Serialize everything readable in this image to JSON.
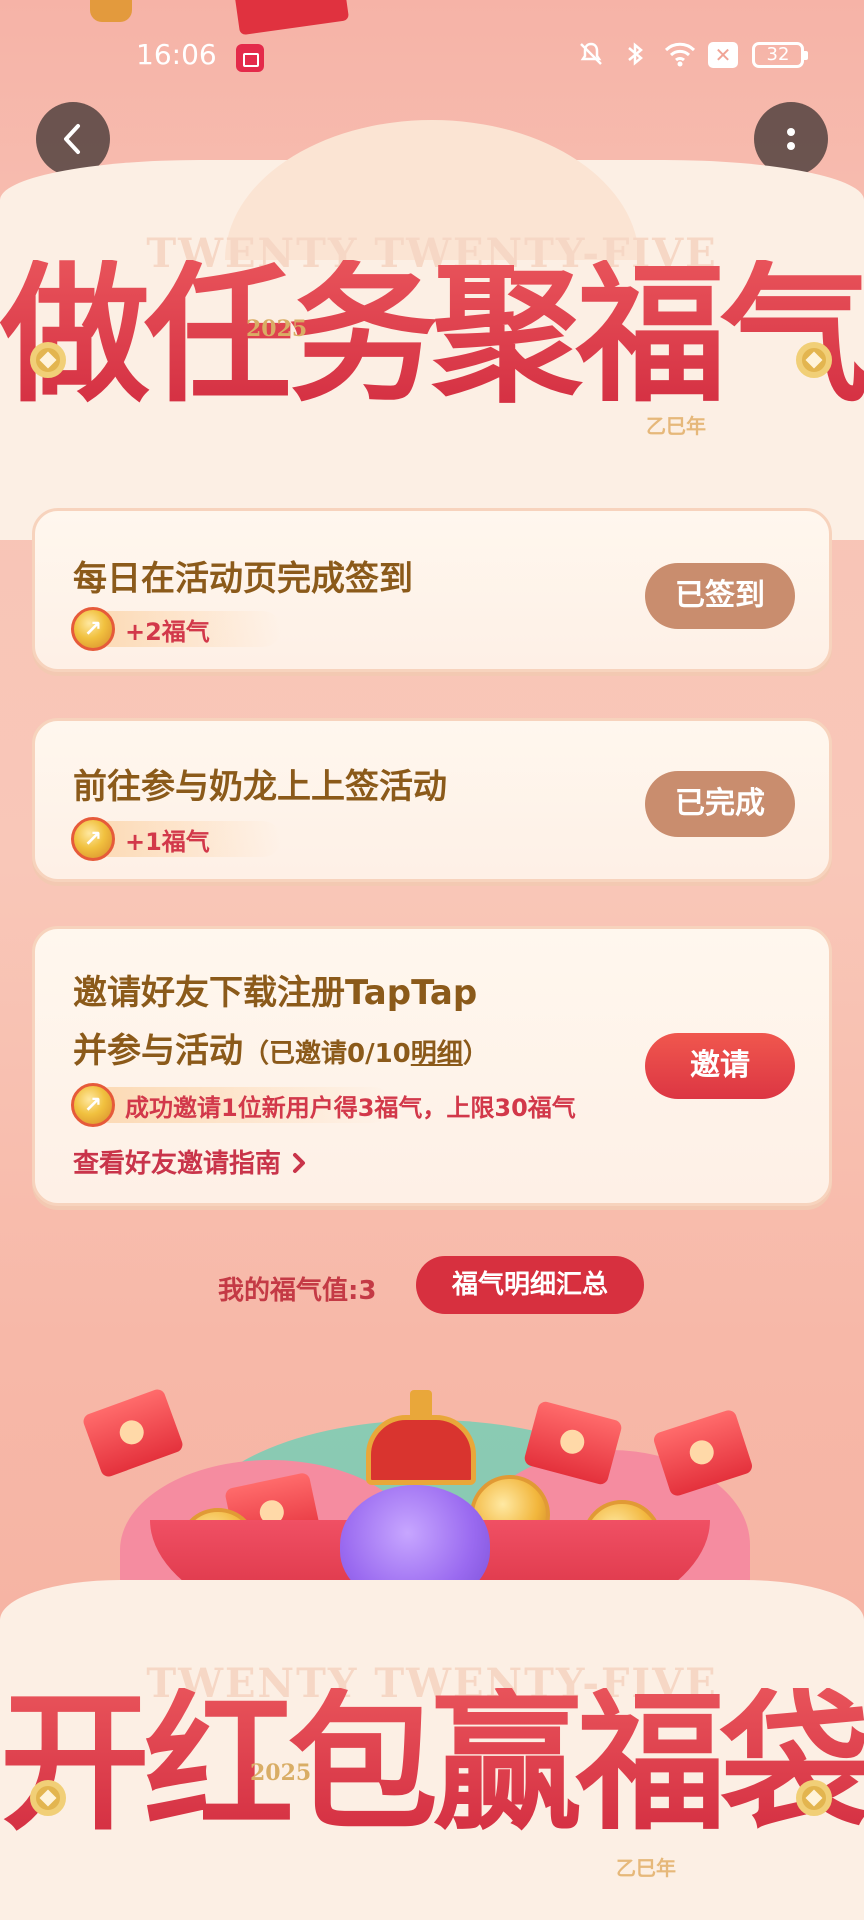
{
  "status_bar": {
    "time": "16:06",
    "battery": "32",
    "icons": [
      "screen-record-icon",
      "mute-icon",
      "bluetooth-icon",
      "wifi-icon",
      "no-sim-icon",
      "battery-icon"
    ]
  },
  "nav": {
    "back_icon": "chevron-left-icon",
    "more_icon": "more-vertical-icon"
  },
  "header": {
    "watermark": "TWENTY TWENTY-FIVE",
    "title": "做任务聚福气",
    "year": "2025",
    "zodiac": "乙巳年"
  },
  "tasks": [
    {
      "title": "每日在活动页完成签到",
      "reward": "+2福气",
      "button": "已签到"
    },
    {
      "title": "前往参与奶龙上上签活动",
      "reward": "+1福气",
      "button": "已完成"
    },
    {
      "title_line1": "邀请好友下载注册TapTap",
      "title_line2": "并参与活动",
      "invite_prefix": "（已邀请0/10",
      "invite_link": "明细",
      "invite_suffix": "）",
      "reward": "成功邀请1位新用户得3福气，上限30福气",
      "guide": "查看好友邀请指南",
      "button": "邀请"
    }
  ],
  "fortune": {
    "label": "我的福气值:3",
    "button": "福气明细汇总"
  },
  "bottom_banner": {
    "watermark": "TWENTY TWENTY-FIVE",
    "title": "开红包赢福袋",
    "year": "2025",
    "zodiac": "乙巳年"
  },
  "colors": {
    "accent_red": "#d7303f",
    "done_button": "#c98d6e",
    "title_brown": "#8b5a1a"
  }
}
